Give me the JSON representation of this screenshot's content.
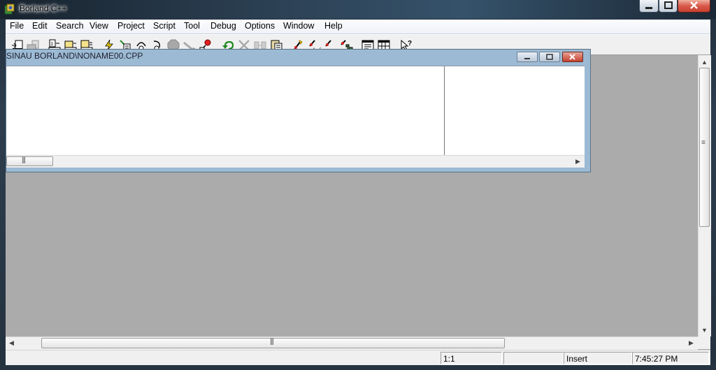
{
  "window": {
    "title": "Borland C++",
    "controls": [
      "minimize",
      "maximize",
      "close"
    ]
  },
  "menu": {
    "items": [
      "File",
      "Edit",
      "Search",
      "View",
      "Project",
      "Script",
      "Tool",
      "Debug",
      "Options",
      "Window",
      "Help"
    ]
  },
  "toolbar": {
    "buttons": [
      "open-project-icon",
      "save-project-icon",
      "compile-icon",
      "make-icon",
      "build-all-icon",
      "lightning-icon",
      "run-icon",
      "step-over-icon",
      "trace-into-icon",
      "stop-icon",
      "pause-icon",
      "breakpoint-icon",
      "undo-icon",
      "cut-icon",
      "copy-icon",
      "paste-icon",
      "find-icon",
      "replace-icon",
      "search-again-icon",
      "browse-icon",
      "window-list-icon",
      "grid-icon",
      "help-pointer-icon"
    ]
  },
  "editor": {
    "title": "SINAU BORLAND\\NONAME00.CPP",
    "controls": [
      "minimize",
      "restore",
      "close"
    ]
  },
  "statusbar": {
    "position": "1:1",
    "mode": "Insert",
    "time": "7:45:27 PM"
  },
  "colors": {
    "client_background": "#ababab",
    "menu_background": "#f0f2f8",
    "editor_frame": "#9cbad3"
  }
}
